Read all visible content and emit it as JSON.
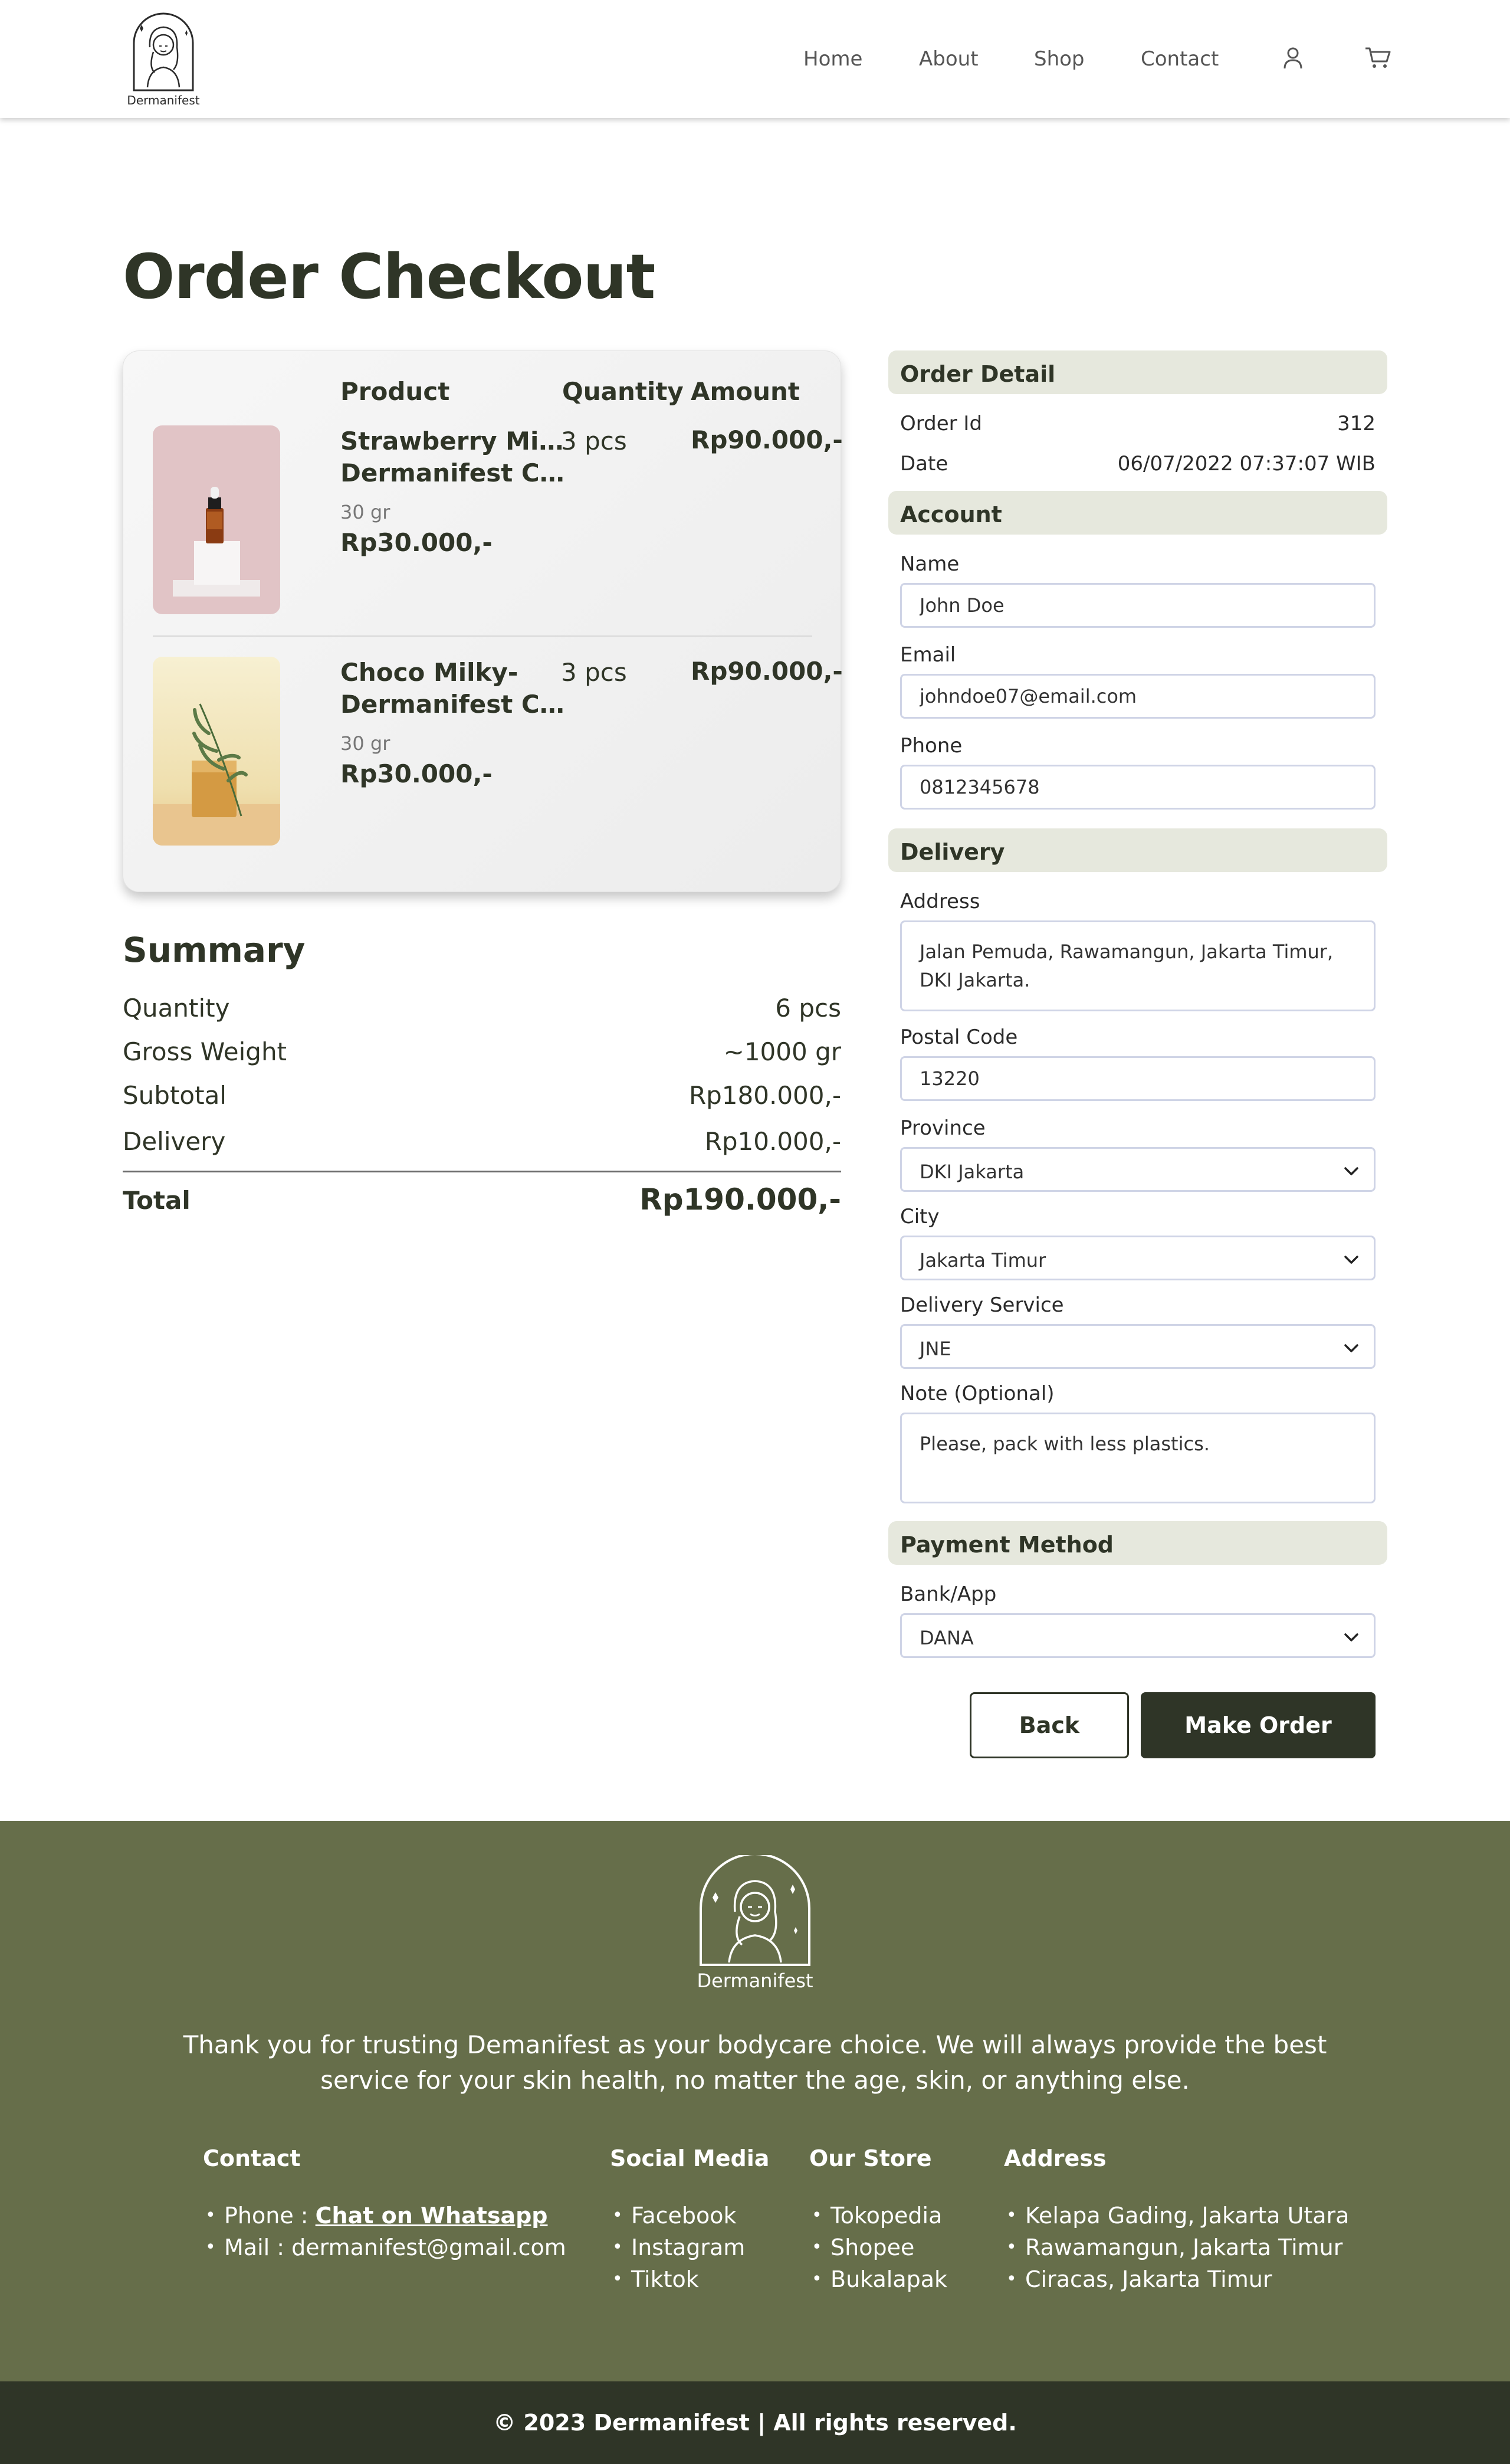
{
  "brand": {
    "name": "Dermanifest"
  },
  "nav": {
    "home": "Home",
    "about": "About",
    "shop": "Shop",
    "contact": "Contact"
  },
  "page": {
    "title": "Order Checkout"
  },
  "cart": {
    "headers": {
      "product": "Product",
      "quantity": "Quantity",
      "amount": "Amount"
    },
    "items": [
      {
        "name_line1": "Strawberry Milky-",
        "name_line2": "Dermanifest Clas...",
        "weight": "30 gr",
        "price": "Rp30.000,-",
        "quantity": "3 pcs",
        "amount": "Rp90.000,-"
      },
      {
        "name_line1": "Choco Milky-",
        "name_line2": "Dermanifest Clas...",
        "weight": "30 gr",
        "price": "Rp30.000,-",
        "quantity": "3 pcs",
        "amount": "Rp90.000,-"
      }
    ]
  },
  "summary": {
    "title": "Summary",
    "rows": [
      {
        "label": "Quantity",
        "value": "6 pcs"
      },
      {
        "label": "Gross Weight",
        "value": "~1000 gr"
      },
      {
        "label": "Subtotal",
        "value": "Rp180.000,-"
      },
      {
        "label": "Delivery",
        "value": "Rp10.000,-"
      }
    ],
    "total": {
      "label": "Total",
      "value": "Rp190.000,-"
    }
  },
  "order_detail": {
    "title": "Order Detail",
    "order_id_label": "Order Id",
    "order_id": "312",
    "date_label": "Date",
    "date": "06/07/2022 07:37:07 WIB"
  },
  "account": {
    "title": "Account",
    "name_label": "Name",
    "name": "John Doe",
    "email_label": "Email",
    "email": "johndoe07@email.com",
    "phone_label": "Phone",
    "phone": "0812345678"
  },
  "delivery": {
    "title": "Delivery",
    "address_label": "Address",
    "address_line1": "Jalan Pemuda, Rawamangun, Jakarta Timur,",
    "address_line2": "DKI Jakarta.",
    "postal_label": "Postal Code",
    "postal": "13220",
    "province_label": "Province",
    "province": "DKI Jakarta",
    "city_label": "City",
    "city": "Jakarta Timur",
    "service_label": "Delivery Service",
    "service": "JNE",
    "note_label": "Note (Optional)",
    "note": "Please, pack with less plastics."
  },
  "payment": {
    "title": "Payment Method",
    "bank_label": "Bank/App",
    "bank": "DANA"
  },
  "actions": {
    "back": "Back",
    "make_order": "Make Order"
  },
  "footer": {
    "brand": "Dermanifest",
    "tagline_line1": "Thank you for trusting Demanifest as your bodycare choice. We will always provide the best",
    "tagline_line2": "service for your skin health, no matter the age, skin, or anything else.",
    "contact": {
      "title": "Contact",
      "phone_prefix": "Phone : ",
      "phone_link": "Chat on Whatsapp",
      "mail": "Mail : dermanifest@gmail.com"
    },
    "social": {
      "title": "Social Media",
      "items": [
        "Facebook",
        "Instagram",
        "Tiktok"
      ]
    },
    "store": {
      "title": "Our Store",
      "items": [
        "Tokopedia",
        "Shopee",
        "Bukalapak"
      ]
    },
    "address": {
      "title": "Address",
      "items": [
        "Kelapa Gading, Jakarta Utara",
        "Rawamangun, Jakarta Timur",
        "Ciracas, Jakarta Timur"
      ]
    },
    "copyright": "© 2023 Dermanifest | All rights reserved."
  },
  "colors": {
    "primary_dark": "#2f3527",
    "footer_green": "#666e4a",
    "section_bg": "#e6e8dd",
    "input_border": "#cfd4e6"
  },
  "icons": {
    "user": "user-icon",
    "cart": "cart-icon",
    "chevron": "chevron-down-icon"
  }
}
